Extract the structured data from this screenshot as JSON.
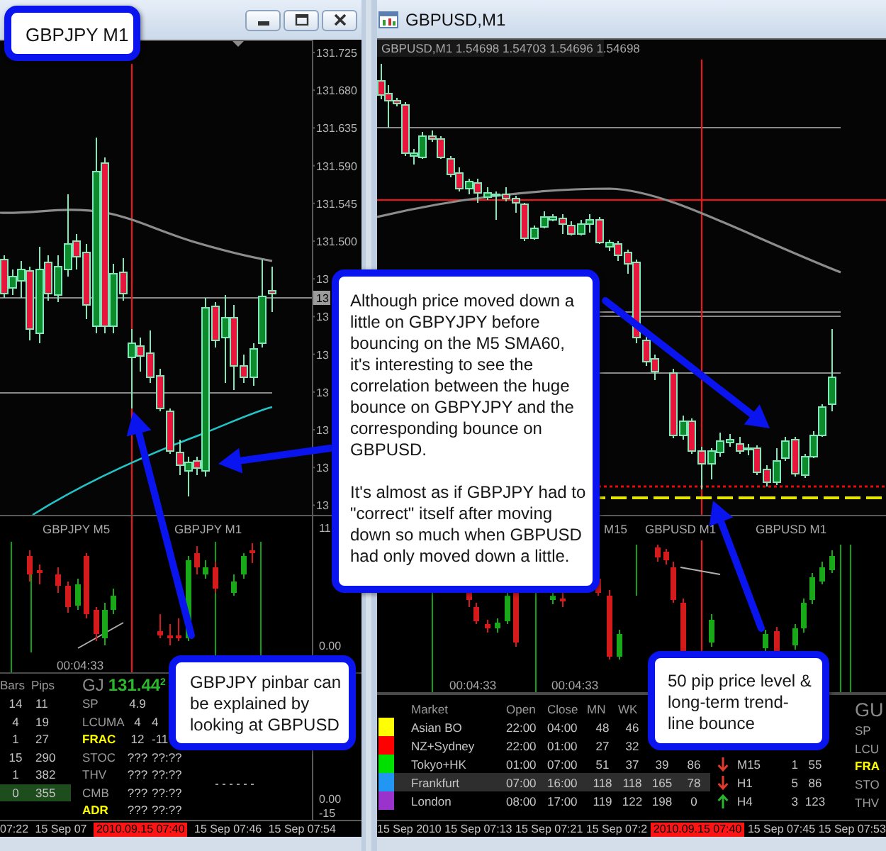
{
  "left_window": {
    "price_axis": [
      "131.725",
      "131.680",
      "131.635",
      "131.590",
      "131.545",
      "131.500",
      "13",
      "13",
      "13",
      "13",
      "13",
      "13",
      "13"
    ],
    "current_price": "13",
    "subwindow": {
      "labels": [
        "GBPJPY M5",
        "GBPJPY M1"
      ],
      "timer": "00:04:33",
      "axis": [
        "11",
        "0.00"
      ]
    },
    "panel": {
      "axis": [
        "0.00",
        "-15"
      ],
      "stats_columns": [
        "Bars",
        "Pips"
      ],
      "stats": [
        {
          "bars": "14",
          "pips": "11",
          "highlighted": false
        },
        {
          "bars": "4",
          "pips": "19",
          "highlighted": false
        },
        {
          "bars": "1",
          "pips": "27",
          "highlighted": false
        },
        {
          "bars": "15",
          "pips": "290",
          "highlighted": false
        },
        {
          "bars": "1",
          "pips": "382",
          "highlighted": false
        },
        {
          "bars": "0",
          "pips": "355",
          "highlighted": true
        }
      ],
      "symbol": "GJ",
      "price": "131.44$^{2}$",
      "indicators": [
        {
          "name": "SP",
          "values": [
            "4.9"
          ],
          "flagged": false
        },
        {
          "name": "LCUMA",
          "values": [
            "4",
            "4"
          ],
          "flagged": false
        },
        {
          "name": "FRAC",
          "values": [
            "12",
            "-11"
          ],
          "flagged": true
        },
        {
          "name": "STOC",
          "values": [
            "???",
            "??:??"
          ],
          "flagged": false
        },
        {
          "name": "THV",
          "values": [
            "???",
            "??:??"
          ],
          "flagged": false
        },
        {
          "name": "CMB",
          "values": [
            "???",
            "??:??"
          ],
          "flagged": false
        },
        {
          "name": "ADR",
          "values": [
            "???",
            "??:??"
          ],
          "flagged": true
        }
      ]
    },
    "time_axis": [
      {
        "label": "07:22",
        "kind": "tick"
      },
      {
        "label": "15 Sep 07",
        "kind": "tick"
      },
      {
        "label": "2010.09.15 07:40",
        "kind": "crosshair"
      },
      {
        "label": "15 Sep 07:46",
        "kind": "tick"
      },
      {
        "label": "15 Sep 07:54",
        "kind": "tick"
      }
    ]
  },
  "right_window": {
    "title": "GBPUSD,M1",
    "chart_header": "GBPUSD,M1 1.54698 1.54703 1.54696 1.54698",
    "subwindow": {
      "labels": [
        "M15",
        "GBPUSD M1",
        "GBPUSD M1"
      ],
      "timers": [
        "00:04:33",
        "00:04:33"
      ]
    },
    "sessions": {
      "columns": [
        "Market",
        "Open",
        "Close",
        "MN",
        "WK"
      ],
      "rows": [
        {
          "color": "#ffff00",
          "cells": [
            "Asian BO",
            "22:00",
            "04:00",
            "48",
            "46"
          ],
          "highlighted": false
        },
        {
          "color": "#ff0000",
          "cells": [
            "NZ+Sydney",
            "22:00",
            "01:00",
            "27",
            "32"
          ],
          "highlighted": false
        },
        {
          "color": "#00e000",
          "cells": [
            "Tokyo+HK",
            "01:00",
            "07:00",
            "51",
            "37",
            "39",
            "86"
          ],
          "highlighted": false,
          "trend": {
            "kind": "down",
            "timeframe": "M15",
            "values": [
              "1",
              "55"
            ]
          }
        },
        {
          "color": "#2196f3",
          "cells": [
            "Frankfurt",
            "07:00",
            "16:00",
            "118",
            "118",
            "165",
            "78"
          ],
          "highlighted": true,
          "trend": {
            "kind": "down",
            "timeframe": "H1",
            "values": [
              "5",
              "86"
            ]
          }
        },
        {
          "color": "#9933cc",
          "cells": [
            "London",
            "08:00",
            "17:00",
            "119",
            "122",
            "198",
            "0"
          ],
          "highlighted": false,
          "trend": {
            "kind": "up",
            "timeframe": "H4",
            "values": [
              "3",
              "123"
            ]
          }
        }
      ]
    },
    "side_panel": {
      "symbol": "GU",
      "labels": [
        {
          "name": "SP",
          "flagged": false
        },
        {
          "name": "LCU",
          "flagged": false
        },
        {
          "name": "FRA",
          "flagged": true
        },
        {
          "name": "STO",
          "flagged": false
        },
        {
          "name": "THV",
          "flagged": false
        }
      ]
    },
    "time_axis": [
      {
        "label": "15 Sep 2010",
        "kind": "tick"
      },
      {
        "label": "15 Sep 07:13",
        "kind": "tick"
      },
      {
        "label": "15 Sep 07:21",
        "kind": "tick"
      },
      {
        "label": "15 Sep 07:2",
        "kind": "tick"
      },
      {
        "label": "2010.09.15 07:40",
        "kind": "crosshair"
      },
      {
        "label": "15 Sep 07:45",
        "kind": "tick"
      },
      {
        "label": "15 Sep 07:53",
        "kind": "tick"
      }
    ]
  },
  "callouts": [
    {
      "paragraphs": [
        "GBPJPY M1"
      ]
    },
    {
      "paragraphs": [
        "Although price moved down a little on GBPYJPY before bouncing on the M5 SMA60, it's interesting to see the correlation between the huge bounce on GBPYJPY and the corresponding bounce on GBPUSD.",
        "It's almost as if GBPJPY had to \"correct\" itself after moving down so much when GBPUSD had only moved down a little."
      ]
    },
    {
      "paragraphs": [
        "GBPJPY pinbar can be explained by looking at GBPUSD"
      ]
    },
    {
      "paragraphs": [
        "50 pip price level & long-term trend-line bounce"
      ]
    }
  ]
}
